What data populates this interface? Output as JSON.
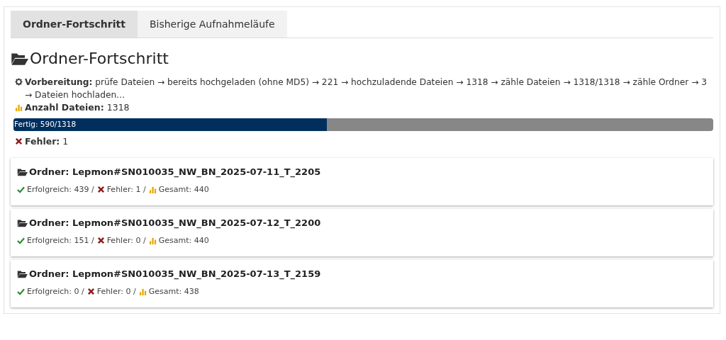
{
  "tabs": [
    {
      "label": "Ordner-Fortschritt",
      "selected": true
    },
    {
      "label": "Bisherige Aufnahmeläufe",
      "selected": false
    }
  ],
  "heading": "Ordner-Fortschritt",
  "preparation": "**Vorbereitung:** prüfe Dateien → bereits hochgeladen (ohne MD5) → 221 → hochzuladende Dateien → 1318 → zähle Dateien → 1318/1318 → zähle Ordner → 3 → Dateien hochladen…",
  "file_count": "**Anzahl Dateien:** 1318",
  "progress": {
    "label": "Fertig: 590/1318",
    "level": 0.4477
  },
  "errors": "**Fehler:** 1",
  "folders": [
    {
      "title": "Ordner: Lepmon#SN010035_NW_BN_2025-07-11_T_2205",
      "success": "Erfolgreich: 439 /",
      "failed": "Fehler: 1 /",
      "total": "Gesamt: 440"
    },
    {
      "title": "Ordner: Lepmon#SN010035_NW_BN_2025-07-12_T_2200",
      "success": "Erfolgreich: 151 /",
      "failed": "Fehler: 0 /",
      "total": "Gesamt: 440"
    },
    {
      "title": "Ordner: Lepmon#SN010035_NW_BN_2025-07-13_T_2159",
      "success": "Erfolgreich: 0 /",
      "failed": "Fehler: 0 /",
      "total": "Gesamt: 438"
    }
  ]
}
